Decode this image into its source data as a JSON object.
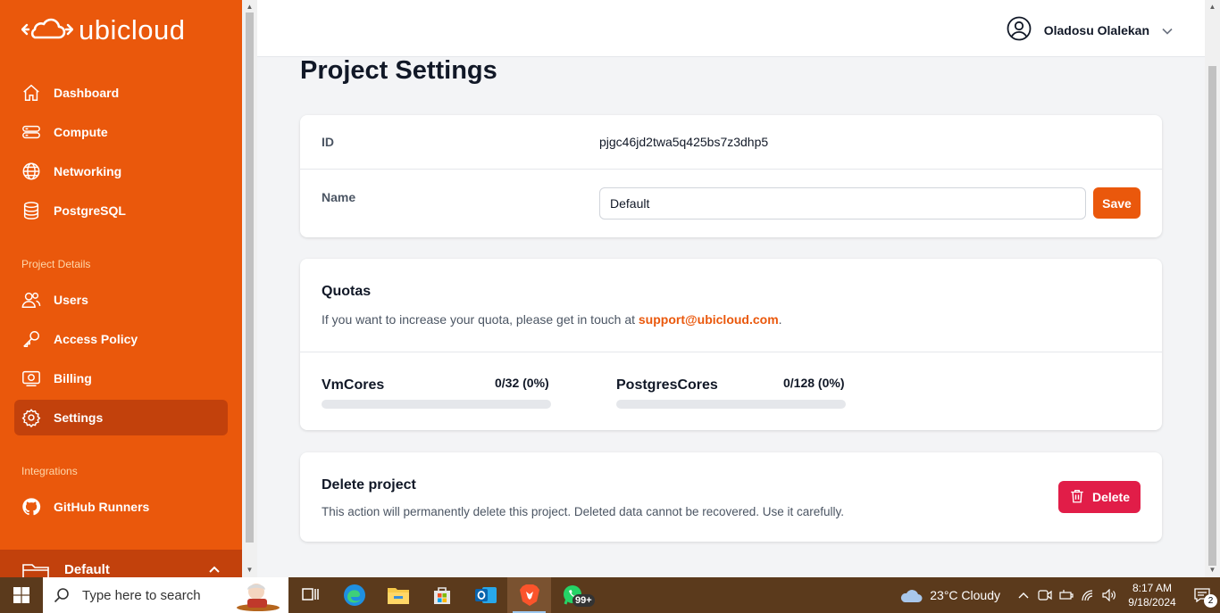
{
  "brand": {
    "name": "ubicloud"
  },
  "sidebar": {
    "main_items": [
      {
        "label": "Dashboard",
        "icon": "home-icon"
      },
      {
        "label": "Compute",
        "icon": "server-icon"
      },
      {
        "label": "Networking",
        "icon": "globe-icon"
      },
      {
        "label": "PostgreSQL",
        "icon": "database-icon"
      }
    ],
    "project_section_label": "Project Details",
    "project_items": [
      {
        "label": "Users",
        "icon": "users-icon"
      },
      {
        "label": "Access Policy",
        "icon": "key-icon"
      },
      {
        "label": "Billing",
        "icon": "billing-icon"
      },
      {
        "label": "Settings",
        "icon": "gear-icon",
        "active": true
      }
    ],
    "integrations_section_label": "Integrations",
    "integration_items": [
      {
        "label": "GitHub Runners",
        "icon": "github-icon"
      }
    ],
    "project_switcher": {
      "label": "Default"
    }
  },
  "header": {
    "user_name": "Oladosu Olalekan"
  },
  "page": {
    "title": "Project Settings",
    "details": {
      "id_label": "ID",
      "id_value": "pjgc46jd2twa5q425bs7z3dhp5",
      "name_label": "Name",
      "name_value": "Default",
      "save_label": "Save"
    },
    "quotas": {
      "title": "Quotas",
      "description_prefix": "If you want to increase your quota, please get in touch at ",
      "support_email": "support@ubicloud.com",
      "description_suffix": ".",
      "items": [
        {
          "name": "VmCores",
          "value_text": "0/32 (0%)",
          "used": 0,
          "total": 32,
          "percent": 0
        },
        {
          "name": "PostgresCores",
          "value_text": "0/128 (0%)",
          "used": 0,
          "total": 128,
          "percent": 0
        }
      ]
    },
    "delete": {
      "title": "Delete project",
      "description": "This action will permanently delete this project. Deleted data cannot be recovered. Use it carefully.",
      "button_label": "Delete"
    }
  },
  "taskbar": {
    "search_placeholder": "Type here to search",
    "apps": [
      "task-view-icon",
      "edge-icon",
      "file-explorer-icon",
      "store-icon",
      "outlook-icon",
      "brave-icon",
      "whatsapp-icon"
    ],
    "whatsapp_badge": "99+",
    "weather": "23°C  Cloudy",
    "time": "8:17 AM",
    "date": "9/18/2024",
    "notification_count": "2"
  },
  "colors": {
    "brand": "#ea580c",
    "brand_dark": "#c2410c",
    "danger": "#e11d48"
  }
}
